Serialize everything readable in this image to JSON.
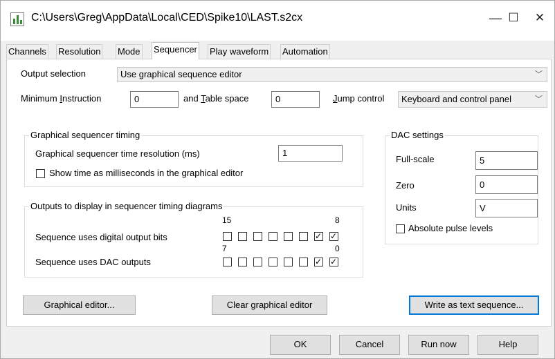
{
  "window": {
    "title": "C:\\Users\\Greg\\AppData\\Local\\CED\\Spike10\\LAST.s2cx",
    "minimize_glyph": "—",
    "maximize_glyph": "☐",
    "close_glyph": "✕"
  },
  "tabs": [
    {
      "label": "Channels"
    },
    {
      "label": "Resolution"
    },
    {
      "label": "Mode"
    },
    {
      "label": "Sequencer",
      "active": true
    },
    {
      "label": "Play waveform"
    },
    {
      "label": "Automation"
    }
  ],
  "sequencer": {
    "output_selection_label": "Output selection",
    "output_selection_value": "Use graphical sequence editor",
    "min_instruction_label_pre": "Minimum ",
    "min_instruction_label_u": "I",
    "min_instruction_label_post": "nstruction",
    "min_instruction_value": "0",
    "table_space_label_pre": "and ",
    "table_space_label_u": "T",
    "table_space_label_post": "able space",
    "table_space_value": "0",
    "jump_control_label_u": "J",
    "jump_control_label_post": "ump control",
    "jump_control_value": "Keyboard and control panel",
    "timing_group": {
      "title": "Graphical sequencer timing",
      "resolution_label": "Graphical sequencer time resolution (ms)",
      "resolution_value": "1",
      "show_ms_label": "Show time as milliseconds in the graphical editor",
      "show_ms_checked": false
    },
    "outputs_group": {
      "title": "Outputs to display in sequencer timing diagrams",
      "digital_label": "Sequence uses digital output bits",
      "digital_high_bit": "15",
      "digital_low_bit": "8",
      "digital_checked": [
        false,
        false,
        false,
        false,
        false,
        false,
        true,
        true
      ],
      "dac_label": "Sequence uses DAC outputs",
      "dac_high_bit": "7",
      "dac_low_bit": "0",
      "dac_checked": [
        false,
        false,
        false,
        false,
        false,
        false,
        true,
        true
      ]
    },
    "dac_group": {
      "title": "DAC settings",
      "full_scale_label": "Full-scale",
      "full_scale_value": "5",
      "zero_label": "Zero",
      "zero_value": "0",
      "units_label": "Units",
      "units_value": "V",
      "absolute_label": "Absolute pulse levels",
      "absolute_checked": false
    },
    "graphical_editor_button": "Graphical editor...",
    "clear_editor_button": "Clear graphical editor",
    "write_text_button": "Write as text sequence..."
  },
  "dialog_buttons": {
    "ok": "OK",
    "cancel": "Cancel",
    "run_now": "Run now",
    "help": "Help"
  }
}
